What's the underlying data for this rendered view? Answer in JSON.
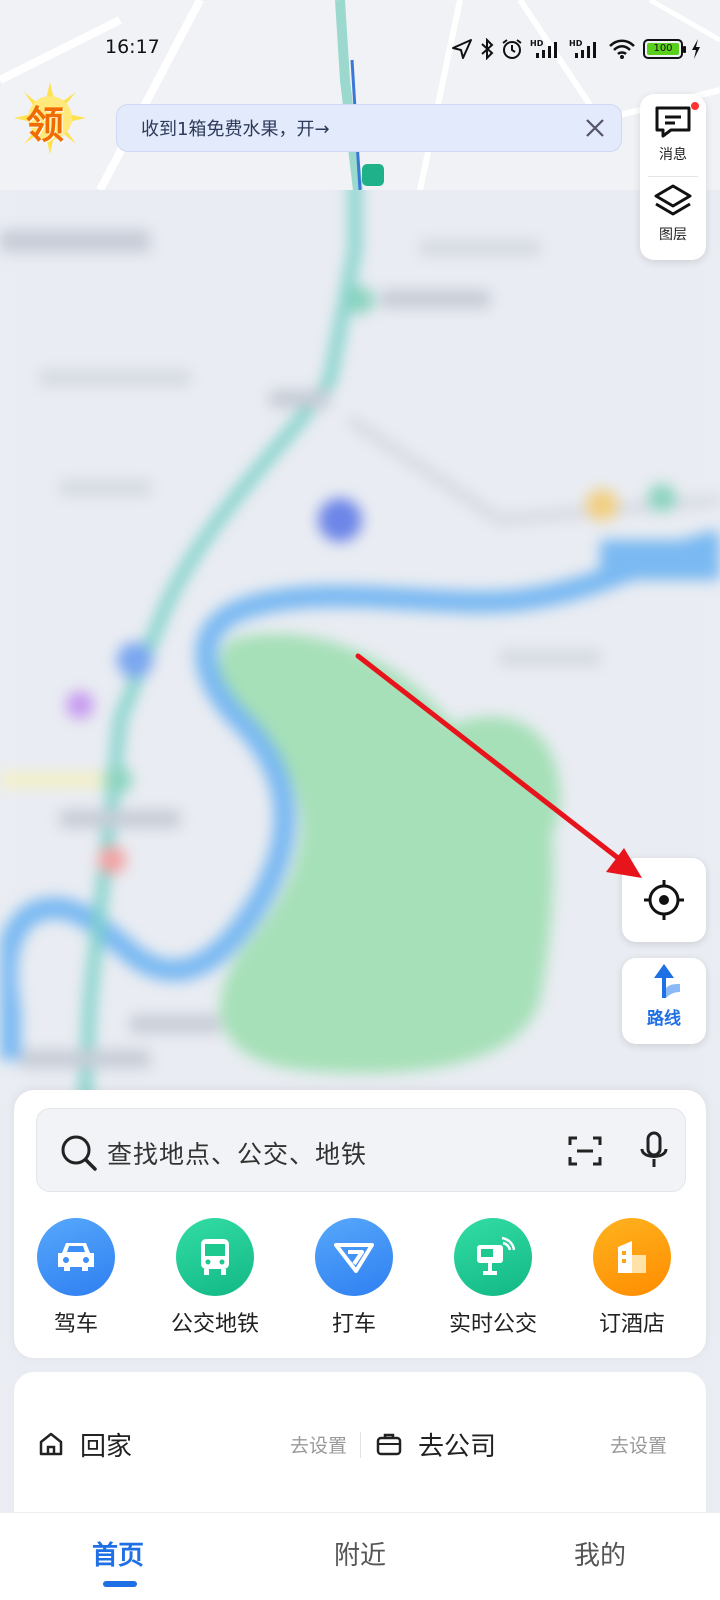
{
  "status_bar": {
    "time": "16:17",
    "battery": "100",
    "icons": [
      "location-icon",
      "bluetooth-icon",
      "alarm-icon",
      "hd-signal-icon",
      "hd-signal-icon",
      "wifi-icon",
      "battery-icon",
      "charging-icon"
    ]
  },
  "promo": {
    "badge": "领",
    "banner_text": "收到1箱免费水果，开→"
  },
  "map_controls": {
    "messages_label": "消息",
    "layers_label": "图层",
    "route_label": "路线"
  },
  "search": {
    "placeholder": "查找地点、公交、地铁"
  },
  "shortcuts": [
    {
      "label": "驾车",
      "icon": "car-icon",
      "color": "#3b8ff6"
    },
    {
      "label": "公交地铁",
      "icon": "bus-icon",
      "color": "#1ec98f"
    },
    {
      "label": "打车",
      "icon": "taxi-icon",
      "color": "#3b8ff6"
    },
    {
      "label": "实时公交",
      "icon": "realtime-bus-icon",
      "color": "#1ec98f"
    },
    {
      "label": "订酒店",
      "icon": "hotel-icon",
      "color": "#ff9d0a"
    }
  ],
  "favorites": {
    "home_label": "回家",
    "home_action": "去设置",
    "work_label": "去公司",
    "work_action": "去设置"
  },
  "tabs": [
    {
      "label": "首页",
      "active": true
    },
    {
      "label": "附近",
      "active": false
    },
    {
      "label": "我的",
      "active": false
    }
  ],
  "colors": {
    "accent": "#1f6fe5",
    "arrow": "#e8141c",
    "park": "#a6e0b8",
    "river": "#7ab9f2"
  }
}
